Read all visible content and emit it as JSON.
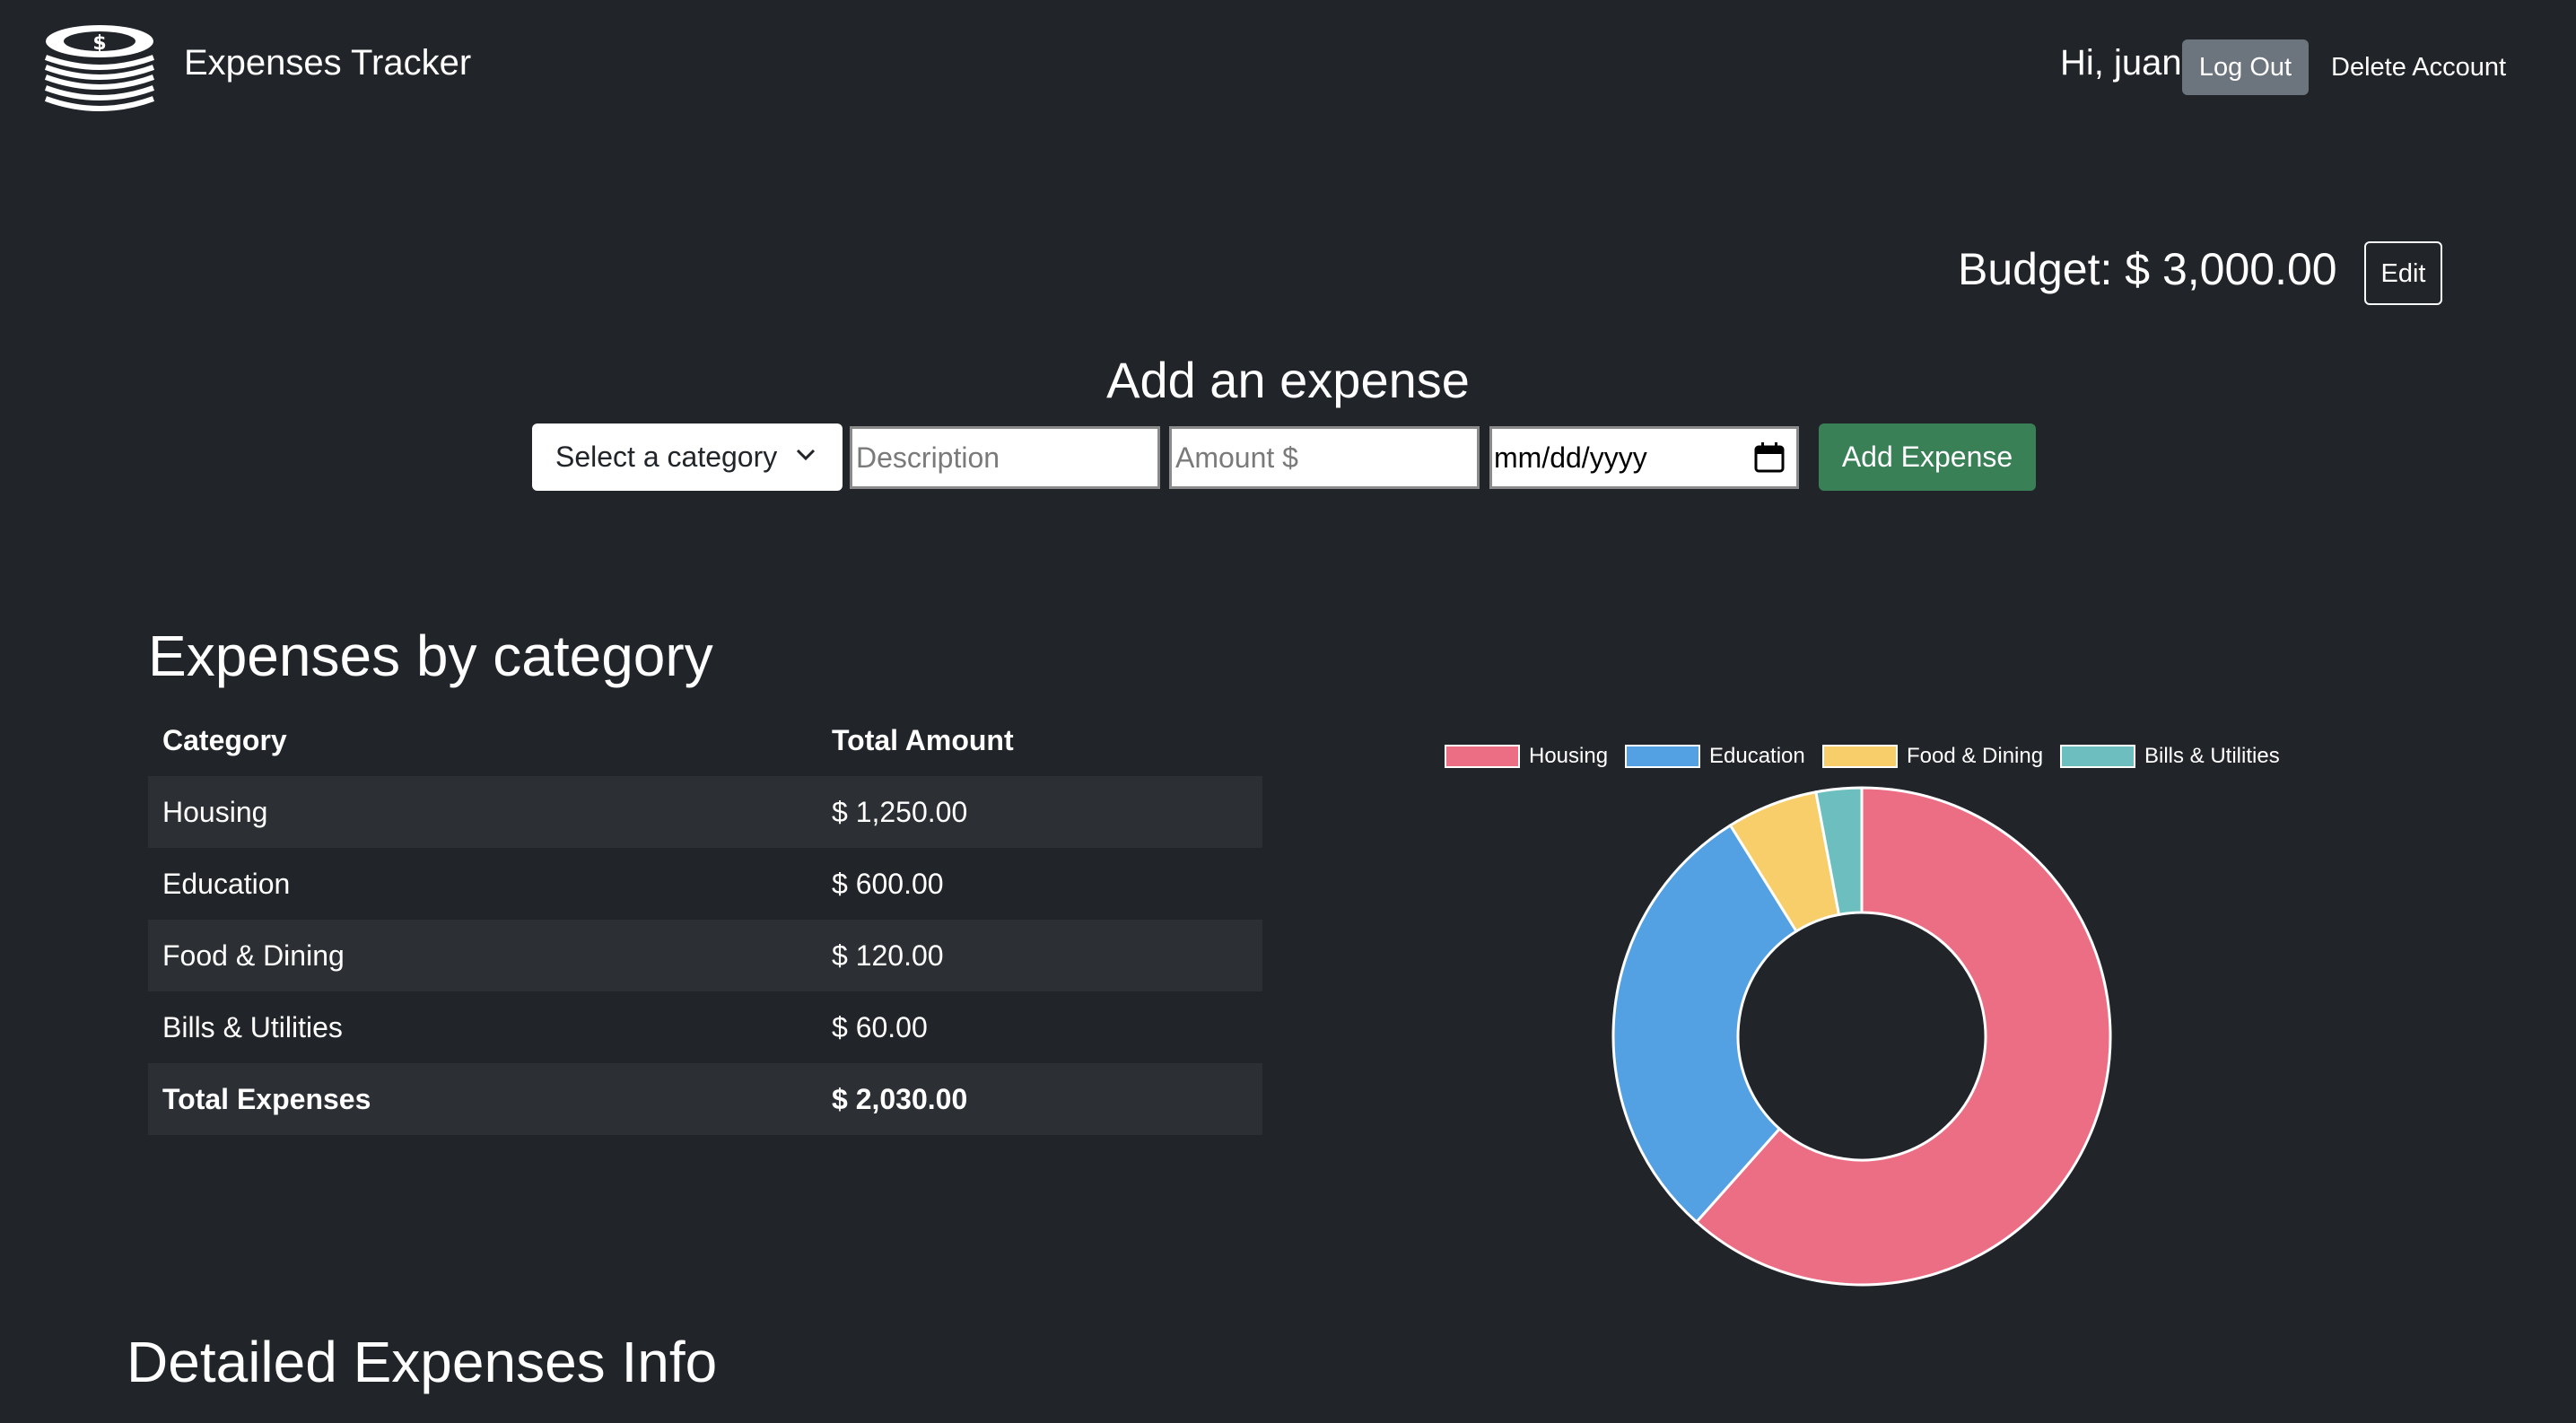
{
  "navbar": {
    "brand": "Expenses Tracker",
    "greeting": "Hi, juan",
    "logout_label": "Log Out",
    "delete_label": "Delete Account",
    "logo_icon": "coin-stack-icon"
  },
  "budget": {
    "label": "Budget: $ 3,000.00",
    "edit_label": "Edit"
  },
  "add_form": {
    "title": "Add an expense",
    "category_selected": "Select a category",
    "description_placeholder": "Description",
    "amount_placeholder": "Amount $",
    "date_value": "mm/dd/yyyy",
    "submit_label": "Add Expense"
  },
  "by_category": {
    "title": "Expenses by category",
    "headers": [
      "Category",
      "Total Amount"
    ],
    "rows": [
      {
        "category": "Housing",
        "amount": "$ 1,250.00"
      },
      {
        "category": "Education",
        "amount": "$ 600.00"
      },
      {
        "category": "Food & Dining",
        "amount": "$ 120.00"
      },
      {
        "category": "Bills & Utilities",
        "amount": "$ 60.00"
      }
    ],
    "total": {
      "label": "Total Expenses",
      "amount": "$ 2,030.00"
    }
  },
  "chart_data": {
    "type": "pie",
    "style": "doughnut",
    "categories": [
      "Housing",
      "Education",
      "Food & Dining",
      "Bills & Utilities"
    ],
    "values": [
      1250,
      600,
      120,
      60
    ],
    "colors": [
      "#ec6e85",
      "#53a0e2",
      "#f8ce6b",
      "#6cbfbe"
    ],
    "legend_position": "top",
    "title": ""
  },
  "detail": {
    "title": "Detailed Expenses Info"
  }
}
